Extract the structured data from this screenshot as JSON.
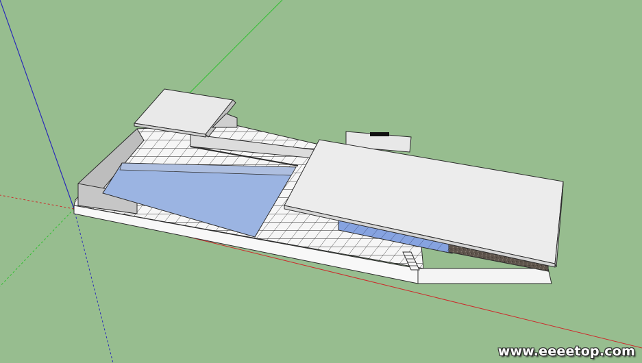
{
  "scene": {
    "background": "#97bd8f",
    "axes": {
      "red": "#cc2a2a",
      "green": "#2fbf2f",
      "blue": "#2a2ab8"
    },
    "colors": {
      "paving": "#f4f4f4",
      "paving_lines": "#2b2b2b",
      "water": "#9bb4e2",
      "glass": "#86a3e0",
      "roof": "#ececec",
      "wall": "#bdbdbd",
      "travertine": "#5a5048"
    }
  },
  "watermark": {
    "text": "www.eeeetop.com"
  }
}
